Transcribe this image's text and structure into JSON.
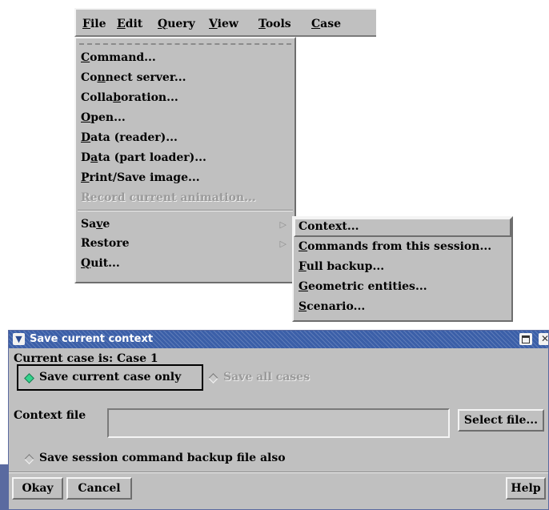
{
  "menubar": {
    "items": [
      "File",
      "Edit",
      "Query",
      "View",
      "Tools",
      "Case"
    ]
  },
  "file_menu": {
    "items": [
      {
        "label": "Command...",
        "enabled": true
      },
      {
        "label": "Connect server...",
        "enabled": true
      },
      {
        "label": "Collaboration...",
        "enabled": true
      },
      {
        "label": "Open...",
        "enabled": true
      },
      {
        "label": "Data (reader)...",
        "enabled": true
      },
      {
        "label": "Data (part loader)...",
        "enabled": true
      },
      {
        "label": "Print/Save image...",
        "enabled": true
      },
      {
        "label": "Record current animation...",
        "enabled": false
      },
      {
        "label": "Save",
        "enabled": true,
        "submenu": true,
        "active": true
      },
      {
        "label": "Restore",
        "enabled": true,
        "submenu": true
      },
      {
        "label": "Quit...",
        "enabled": true
      }
    ]
  },
  "save_submenu": {
    "items": [
      "Context...",
      "Commands from this session...",
      "Full backup...",
      "Geometric entities...",
      "Scenario..."
    ]
  },
  "dialog": {
    "title": "Save current context",
    "current_case": "Current case is: Case 1",
    "radio_current": "Save current case only",
    "radio_all": "Save all cases",
    "radio_selected": "current",
    "context_file_label": "Context file",
    "context_file_value": "",
    "select_file_button": "Select file...",
    "backup_option": "Save session command backup file also",
    "backup_checked": false,
    "okay_button": "Okay",
    "cancel_button": "Cancel",
    "help_button": "Help"
  },
  "colors": {
    "panel": "#c0c0c0",
    "titlebar": "#3b5fa8",
    "radio_on": "#33d38c"
  },
  "icons": {
    "title_menu": "chevron-down-icon",
    "submenu_arrow": "triangle-right-icon",
    "maximize": "maximize-icon",
    "close": "close-icon"
  }
}
